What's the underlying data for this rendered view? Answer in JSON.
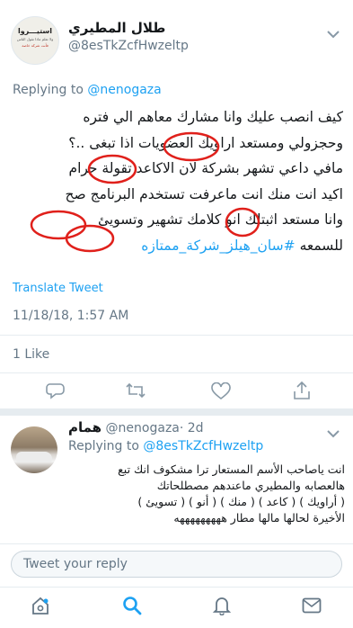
{
  "tweet": {
    "avatar_text": [
      "استيـــروا",
      "ولا تعلم ماذا تقول الناس",
      "فأنت شركة خاصة"
    ],
    "display_name": "طلال المطيري",
    "handle": "@8esTkZcfHwzeltp",
    "replying_to_prefix": "Replying to",
    "replying_to_handle": "@nenogaza",
    "lines": [
      "كيف انصب عليك وانا مشارك معاهم الي فتره",
      "وحجزولي ومستعد اراويك العضويات اذا تبغى ..؟",
      "مافي داعي تشهر بشركة لان الاكاعد تقولة حرام",
      "اكيد انت منك انت ماعرفت تستخدم البرنامج صح",
      "وانا مستعد اثبتلك انو كلامك تشهير وتسويئ"
    ],
    "hashtag_prefix": "للسمعه",
    "hashtag": "#سان_هيلز_شركة_ممتازه",
    "translate": "Translate Tweet",
    "timestamp": "11/18/18, 1:57 AM",
    "likes": "1 Like"
  },
  "reply": {
    "display_name": "همام",
    "handle": "@nenogaza",
    "time": "· 2d",
    "replying_to_prefix": "Replying to",
    "replying_to_handle": "@8esTkZcfHwzeltp",
    "lines": [
      "انت ياصاحب الأسم المستعار ترا مشكوف انك تبع",
      "هالعصابه والمطيري ماعندهم مصطلحاتك",
      "( أراويك ) ( كاعد ) ( منك ) ( أنو ) ( تسويئ )",
      "الأخيرة لحالها مالها مطار هههههههههه"
    ]
  },
  "composer": {
    "placeholder": "Tweet your reply"
  },
  "colors": {
    "accent": "#1da1f2",
    "muted": "#657786",
    "highlight": "#e0201b"
  }
}
